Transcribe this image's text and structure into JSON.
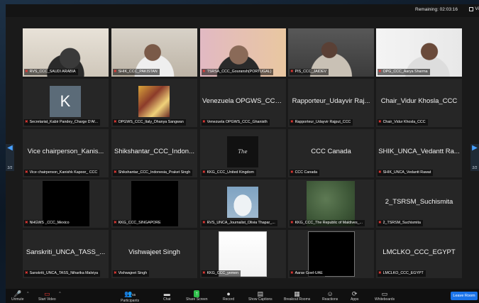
{
  "meeting": {
    "remaining": "Remaining: 02:03:16",
    "view_label": "Vi"
  },
  "pagination": {
    "left": "2/2",
    "right": "2/2"
  },
  "participants": [
    {
      "label": "RVS_CCC_SAUDI ARABIA",
      "big": "",
      "video": "face-light",
      "active": false
    },
    {
      "label": "SHIK_CCC_PAKISTAN",
      "big": "",
      "video": "face-room",
      "active": false
    },
    {
      "label": "TSRSA_CCC_Gouransh(PORTUGAL)",
      "big": "",
      "video": "face-pink",
      "active": true
    },
    {
      "label": "PIS_CCC_JAIDEV",
      "big": "",
      "video": "face-dark",
      "active": false
    },
    {
      "label": "OPG_CCC_Aarya Sharma",
      "big": "",
      "video": "face-white",
      "active": false
    },
    {
      "label": "Secretariat_Kabir Pandey_Charge D'Af...",
      "big": "",
      "video": "avatar-k",
      "active": false
    },
    {
      "label": "OPGWS_CCC_Italy_Dhanya Sangwan",
      "big": "",
      "video": "photo-italy",
      "active": false
    },
    {
      "label": "Venezuela OPGWS_CCC_Ghanisth",
      "big": "Venezuela OPGWS_CCC_...",
      "video": "none",
      "active": false
    },
    {
      "label": "Rapporteur_Udayvir Rajput_CCC",
      "big": "Rapporteur_Udayvir Raj...",
      "video": "none",
      "active": false
    },
    {
      "label": "Chair_Vidur Khosla_CCC",
      "big": "Chair_Vidur Khosla_CCC",
      "video": "none",
      "active": false
    },
    {
      "label": "Vice chairperson_Kanishk Kapoor_ CCC",
      "big": "Vice chairperson_Kanis...",
      "video": "none",
      "active": false
    },
    {
      "label": "Shikshantar_CCC_Indonesia_Praket Singh",
      "big": "Shikshantar_CCC_Indon...",
      "video": "none",
      "active": false
    },
    {
      "label": "KKG_CCC_United Kingdom",
      "big": "",
      "video": "awesome",
      "active": false
    },
    {
      "label": "CCC Canada",
      "big": "CCC Canada",
      "video": "none",
      "active": false
    },
    {
      "label": "SHIK_UNCA_Vedantt Rawat",
      "big": "SHIK_UNCA_Vedantt Ra...",
      "video": "none",
      "active": false
    },
    {
      "label": "NHGWS _CCC_Mexico",
      "big": "",
      "video": "black",
      "active": false
    },
    {
      "label": "KKG_CCC_SINGAPORE",
      "big": "",
      "video": "black",
      "active": false
    },
    {
      "label": "RVS_UNCA_Journalist_Olivia Thapar_...",
      "big": "",
      "video": "bird",
      "active": false
    },
    {
      "label": "KKG_CCC_The Republic of Maldives_...",
      "big": "",
      "video": "green-blur",
      "active": false
    },
    {
      "label": "2_TSRSM_Suchismita",
      "big": "2_TSRSM_Suchismita",
      "video": "none",
      "active": false
    },
    {
      "label": "Sanskriti_UNCA_TASS_Niharika Malviya",
      "big": "Sanskriti_UNCA_TASS_...",
      "video": "none",
      "active": false
    },
    {
      "label": "Vishwajeet Singh",
      "big": "Vishwajeet Singh",
      "video": "none",
      "active": false
    },
    {
      "label": "KKG_CCC_yemen",
      "big": "",
      "video": "document",
      "active": false
    },
    {
      "label": "Aarav Goel-UAE",
      "big": "",
      "video": "black-framed",
      "active": false
    },
    {
      "label": "LMCLKO_CCC_EGYPT",
      "big": "LMCLKO_CCC_EGYPT",
      "video": "none",
      "active": false
    }
  ],
  "toolbar": {
    "unmute": "Unmute",
    "start_video": "Start Video",
    "participants": "Participants",
    "participants_count": "55",
    "chat": "Chat",
    "share_screen": "Share Screen",
    "record": "Record",
    "show_captions": "Show Captions",
    "breakout_rooms": "Breakout Rooms",
    "reactions": "Reactions",
    "apps": "Apps",
    "whiteboards": "Whiteboards",
    "leave": "Leave Room"
  },
  "colors": {
    "active_border": "#2fbf4b",
    "muted_mic": "#e53935",
    "leave": "#1a73e8"
  }
}
